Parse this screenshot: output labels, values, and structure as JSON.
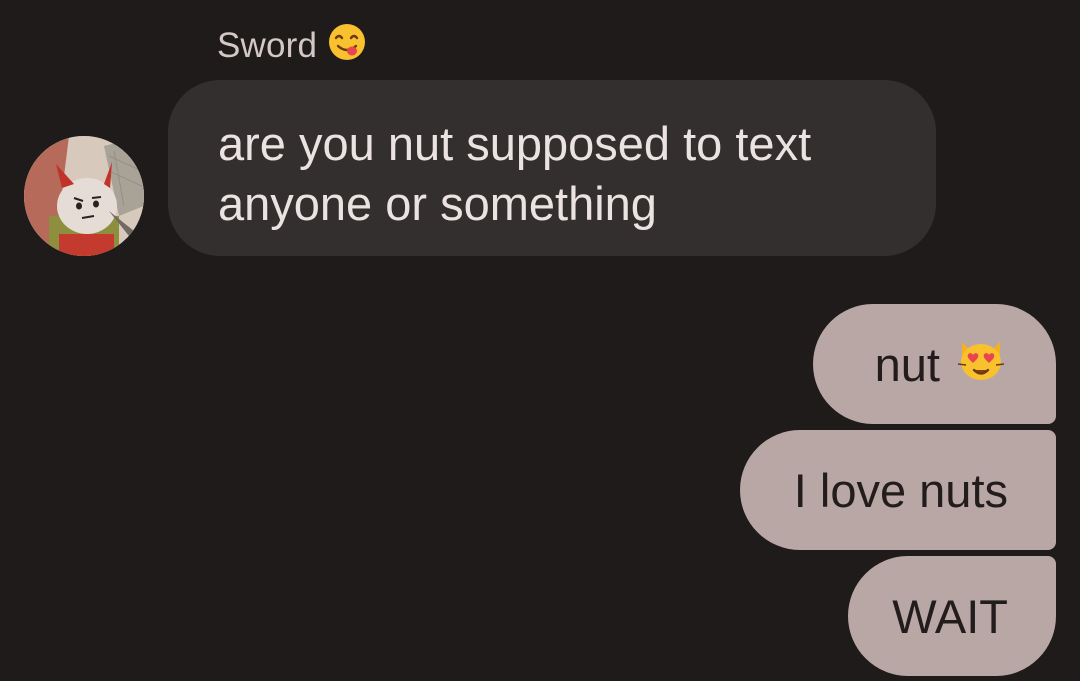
{
  "conversation": {
    "incoming": {
      "sender_name": "Sword",
      "sender_emoji": "face-savoring-food-emoji",
      "avatar": "avatar-image",
      "message": "are you nut supposed to text anyone or something"
    },
    "outgoing": [
      {
        "text": "nut",
        "emoji": "smiling-cat-heart-eyes-emoji"
      },
      {
        "text": "I love nuts"
      },
      {
        "text": "WAIT"
      }
    ]
  },
  "colors": {
    "background": "#1f1b1b",
    "incoming_bubble": "#332f2f",
    "outgoing_bubble": "#b8a7a4",
    "sender_name": "#d3c8c6"
  }
}
